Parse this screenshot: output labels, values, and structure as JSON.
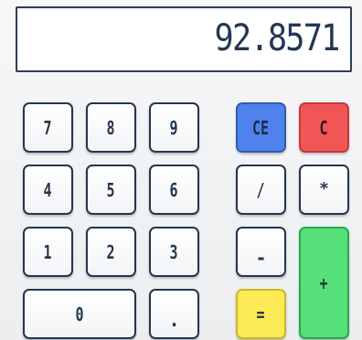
{
  "display": {
    "value": "92.8571"
  },
  "keys": {
    "seven": "7",
    "eight": "8",
    "nine": "9",
    "ce": "CE",
    "clear": "C",
    "four": "4",
    "five": "5",
    "six": "6",
    "divide": "/",
    "multiply": "*",
    "one": "1",
    "two": "2",
    "three": "3",
    "subtract": "-",
    "add": "+",
    "zero": "0",
    "decimal": ".",
    "equals": "="
  },
  "colors": {
    "ce": "#4f82ec",
    "clear": "#f25555",
    "add": "#55e07a",
    "equals": "#fbea53",
    "border": "#23364f",
    "text": "#23364f"
  }
}
